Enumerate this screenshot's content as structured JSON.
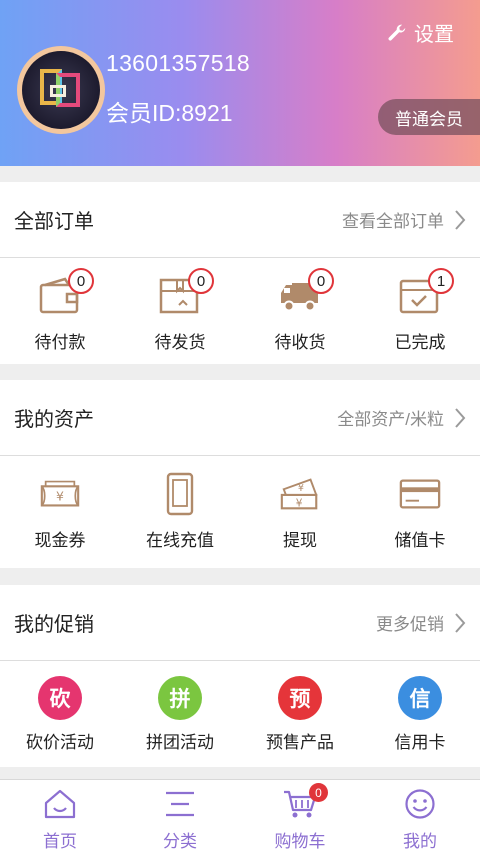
{
  "header": {
    "settings_label": "设置",
    "phone": "13601357518",
    "member_id": "会员ID:8921",
    "level": "普通会员"
  },
  "orders": {
    "title": "全部订单",
    "more": "查看全部订单",
    "items": [
      {
        "label": "待付款",
        "count": "0",
        "icon": "wallet-icon"
      },
      {
        "label": "待发货",
        "count": "0",
        "icon": "package-icon"
      },
      {
        "label": "待收货",
        "count": "0",
        "icon": "truck-icon"
      },
      {
        "label": "已完成",
        "count": "1",
        "icon": "completed-icon"
      }
    ]
  },
  "assets": {
    "title": "我的资产",
    "more": "全部资产/米粒",
    "items": [
      {
        "label": "现金券",
        "icon": "cash-voucher-icon"
      },
      {
        "label": "在线充值",
        "icon": "phone-recharge-icon"
      },
      {
        "label": "提现",
        "icon": "withdraw-icon"
      },
      {
        "label": "储值卡",
        "icon": "stored-card-icon"
      }
    ]
  },
  "promotions": {
    "title": "我的促销",
    "more": "更多促销",
    "items": [
      {
        "label": "砍价活动",
        "glyph": "砍",
        "color": "#e5356f",
        "icon": "bargain-icon"
      },
      {
        "label": "拼团活动",
        "glyph": "拼",
        "color": "#7bc640",
        "icon": "group-buy-icon"
      },
      {
        "label": "预售产品",
        "glyph": "预",
        "color": "#e5353a",
        "icon": "presale-icon"
      },
      {
        "label": "信用卡",
        "glyph": "信",
        "color": "#3b8ee0",
        "icon": "credit-card-icon"
      }
    ]
  },
  "tabbar": {
    "items": [
      {
        "label": "首页",
        "icon": "home-icon"
      },
      {
        "label": "分类",
        "icon": "category-icon"
      },
      {
        "label": "购物车",
        "icon": "cart-icon",
        "badge": "0"
      },
      {
        "label": "我的",
        "icon": "profile-icon"
      }
    ]
  },
  "colors": {
    "icon_brown": "#b08a6a",
    "badge_red": "#e0353a",
    "tab_purple": "#8c6fd1"
  }
}
